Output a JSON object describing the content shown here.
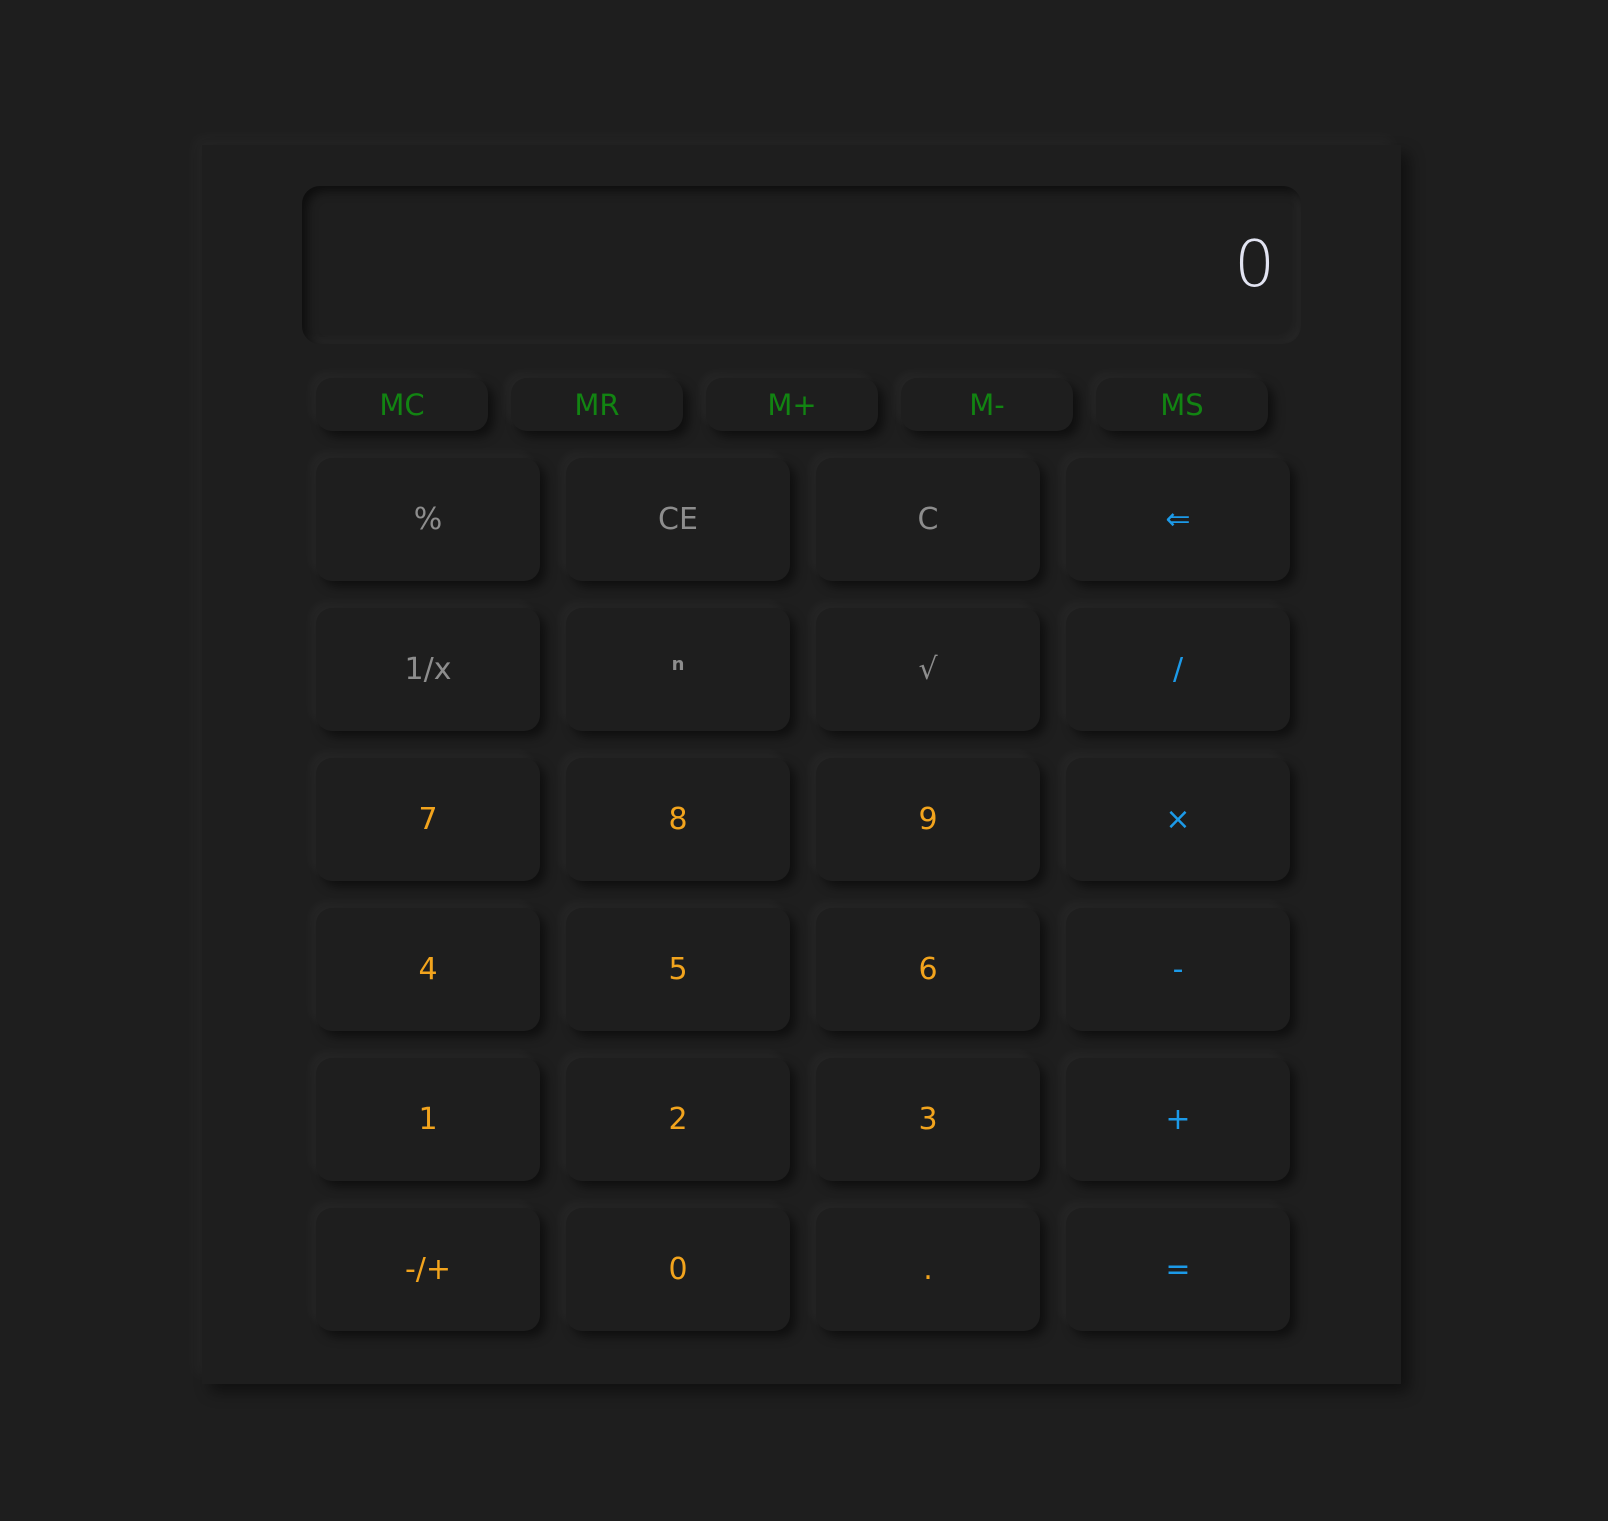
{
  "display": {
    "value": "0"
  },
  "colors": {
    "background": "#1e1e1e",
    "memory": "#128412",
    "function": "#8d8d8d",
    "digit": "#f2a41d",
    "operator": "#1c9ae8",
    "display_text": "#e2e4f2"
  },
  "memory_buttons": [
    {
      "label": "MC"
    },
    {
      "label": "MR"
    },
    {
      "label": "M+"
    },
    {
      "label": "M-"
    },
    {
      "label": "MS"
    }
  ],
  "keys": [
    {
      "label": "%",
      "name": "percent",
      "type": "grey"
    },
    {
      "label": "CE",
      "name": "clear-entry",
      "type": "grey"
    },
    {
      "label": "C",
      "name": "clear",
      "type": "grey"
    },
    {
      "label": "⇐",
      "name": "backspace",
      "type": "blue"
    },
    {
      "label": "1/x",
      "name": "reciprocal",
      "type": "grey"
    },
    {
      "label": "n",
      "name": "power",
      "type": "grey small"
    },
    {
      "label": "√",
      "name": "square-root",
      "type": "grey"
    },
    {
      "label": "/",
      "name": "divide",
      "type": "blue"
    },
    {
      "label": "7",
      "name": "digit-7",
      "type": "orange"
    },
    {
      "label": "8",
      "name": "digit-8",
      "type": "orange"
    },
    {
      "label": "9",
      "name": "digit-9",
      "type": "orange"
    },
    {
      "label": "×",
      "name": "multiply",
      "type": "blue"
    },
    {
      "label": "4",
      "name": "digit-4",
      "type": "orange"
    },
    {
      "label": "5",
      "name": "digit-5",
      "type": "orange"
    },
    {
      "label": "6",
      "name": "digit-6",
      "type": "orange"
    },
    {
      "label": "-",
      "name": "subtract",
      "type": "blue"
    },
    {
      "label": "1",
      "name": "digit-1",
      "type": "orange"
    },
    {
      "label": "2",
      "name": "digit-2",
      "type": "orange"
    },
    {
      "label": "3",
      "name": "digit-3",
      "type": "orange"
    },
    {
      "label": "+",
      "name": "add",
      "type": "blue"
    },
    {
      "label": "-/+",
      "name": "negate",
      "type": "orange"
    },
    {
      "label": "0",
      "name": "digit-0",
      "type": "orange"
    },
    {
      "label": ".",
      "name": "decimal",
      "type": "orange"
    },
    {
      "label": "=",
      "name": "equals",
      "type": "blue"
    }
  ]
}
